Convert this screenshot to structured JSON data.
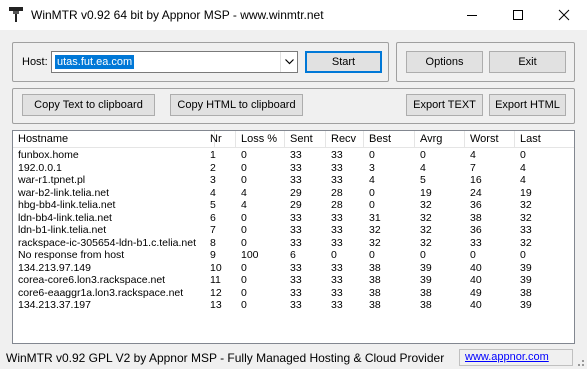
{
  "window": {
    "title": "WinMTR v0.92 64 bit by Appnor MSP - www.winmtr.net"
  },
  "host": {
    "label": "Host:",
    "value": "utas.fut.ea.com"
  },
  "buttons": {
    "start": "Start",
    "options": "Options",
    "exit": "Exit",
    "copy_text": "Copy Text to clipboard",
    "copy_html": "Copy HTML to clipboard",
    "export_text": "Export TEXT",
    "export_html": "Export HTML"
  },
  "table": {
    "columns": [
      "Hostname",
      "Nr",
      "Loss %",
      "Sent",
      "Recv",
      "Best",
      "Avrg",
      "Worst",
      "Last"
    ],
    "rows": [
      [
        "funbox.home",
        "1",
        "0",
        "33",
        "33",
        "0",
        "0",
        "4",
        "0"
      ],
      [
        "192.0.0.1",
        "2",
        "0",
        "33",
        "33",
        "3",
        "4",
        "7",
        "4"
      ],
      [
        "war-r1.tpnet.pl",
        "3",
        "0",
        "33",
        "33",
        "4",
        "5",
        "16",
        "4"
      ],
      [
        "war-b2-link.telia.net",
        "4",
        "4",
        "29",
        "28",
        "0",
        "19",
        "24",
        "19"
      ],
      [
        "hbg-bb4-link.telia.net",
        "5",
        "4",
        "29",
        "28",
        "0",
        "32",
        "36",
        "32"
      ],
      [
        "ldn-bb4-link.telia.net",
        "6",
        "0",
        "33",
        "33",
        "31",
        "32",
        "38",
        "32"
      ],
      [
        "ldn-b1-link.telia.net",
        "7",
        "0",
        "33",
        "33",
        "32",
        "32",
        "36",
        "33"
      ],
      [
        "rackspace-ic-305654-ldn-b1.c.telia.net",
        "8",
        "0",
        "33",
        "33",
        "32",
        "32",
        "33",
        "32"
      ],
      [
        "No response from host",
        "9",
        "100",
        "6",
        "0",
        "0",
        "0",
        "0",
        "0"
      ],
      [
        "134.213.97.149",
        "10",
        "0",
        "33",
        "33",
        "38",
        "39",
        "40",
        "39"
      ],
      [
        "corea-core6.lon3.rackspace.net",
        "11",
        "0",
        "33",
        "33",
        "38",
        "39",
        "40",
        "39"
      ],
      [
        "core6-eaaggr1a.lon3.rackspace.net",
        "12",
        "0",
        "33",
        "33",
        "38",
        "38",
        "49",
        "38"
      ],
      [
        "134.213.37.197",
        "13",
        "0",
        "33",
        "33",
        "38",
        "38",
        "40",
        "39"
      ]
    ]
  },
  "status": {
    "text": "WinMTR v0.92 GPL V2 by Appnor MSP - Fully Managed Hosting & Cloud Provider",
    "link": "www.appnor.com"
  },
  "icons": {
    "app": "winmtr-app-icon",
    "minimize": "minimize-icon",
    "maximize": "maximize-icon",
    "close": "close-icon",
    "dropdown": "chevron-down-icon",
    "resize": "resize-grip-icon"
  }
}
